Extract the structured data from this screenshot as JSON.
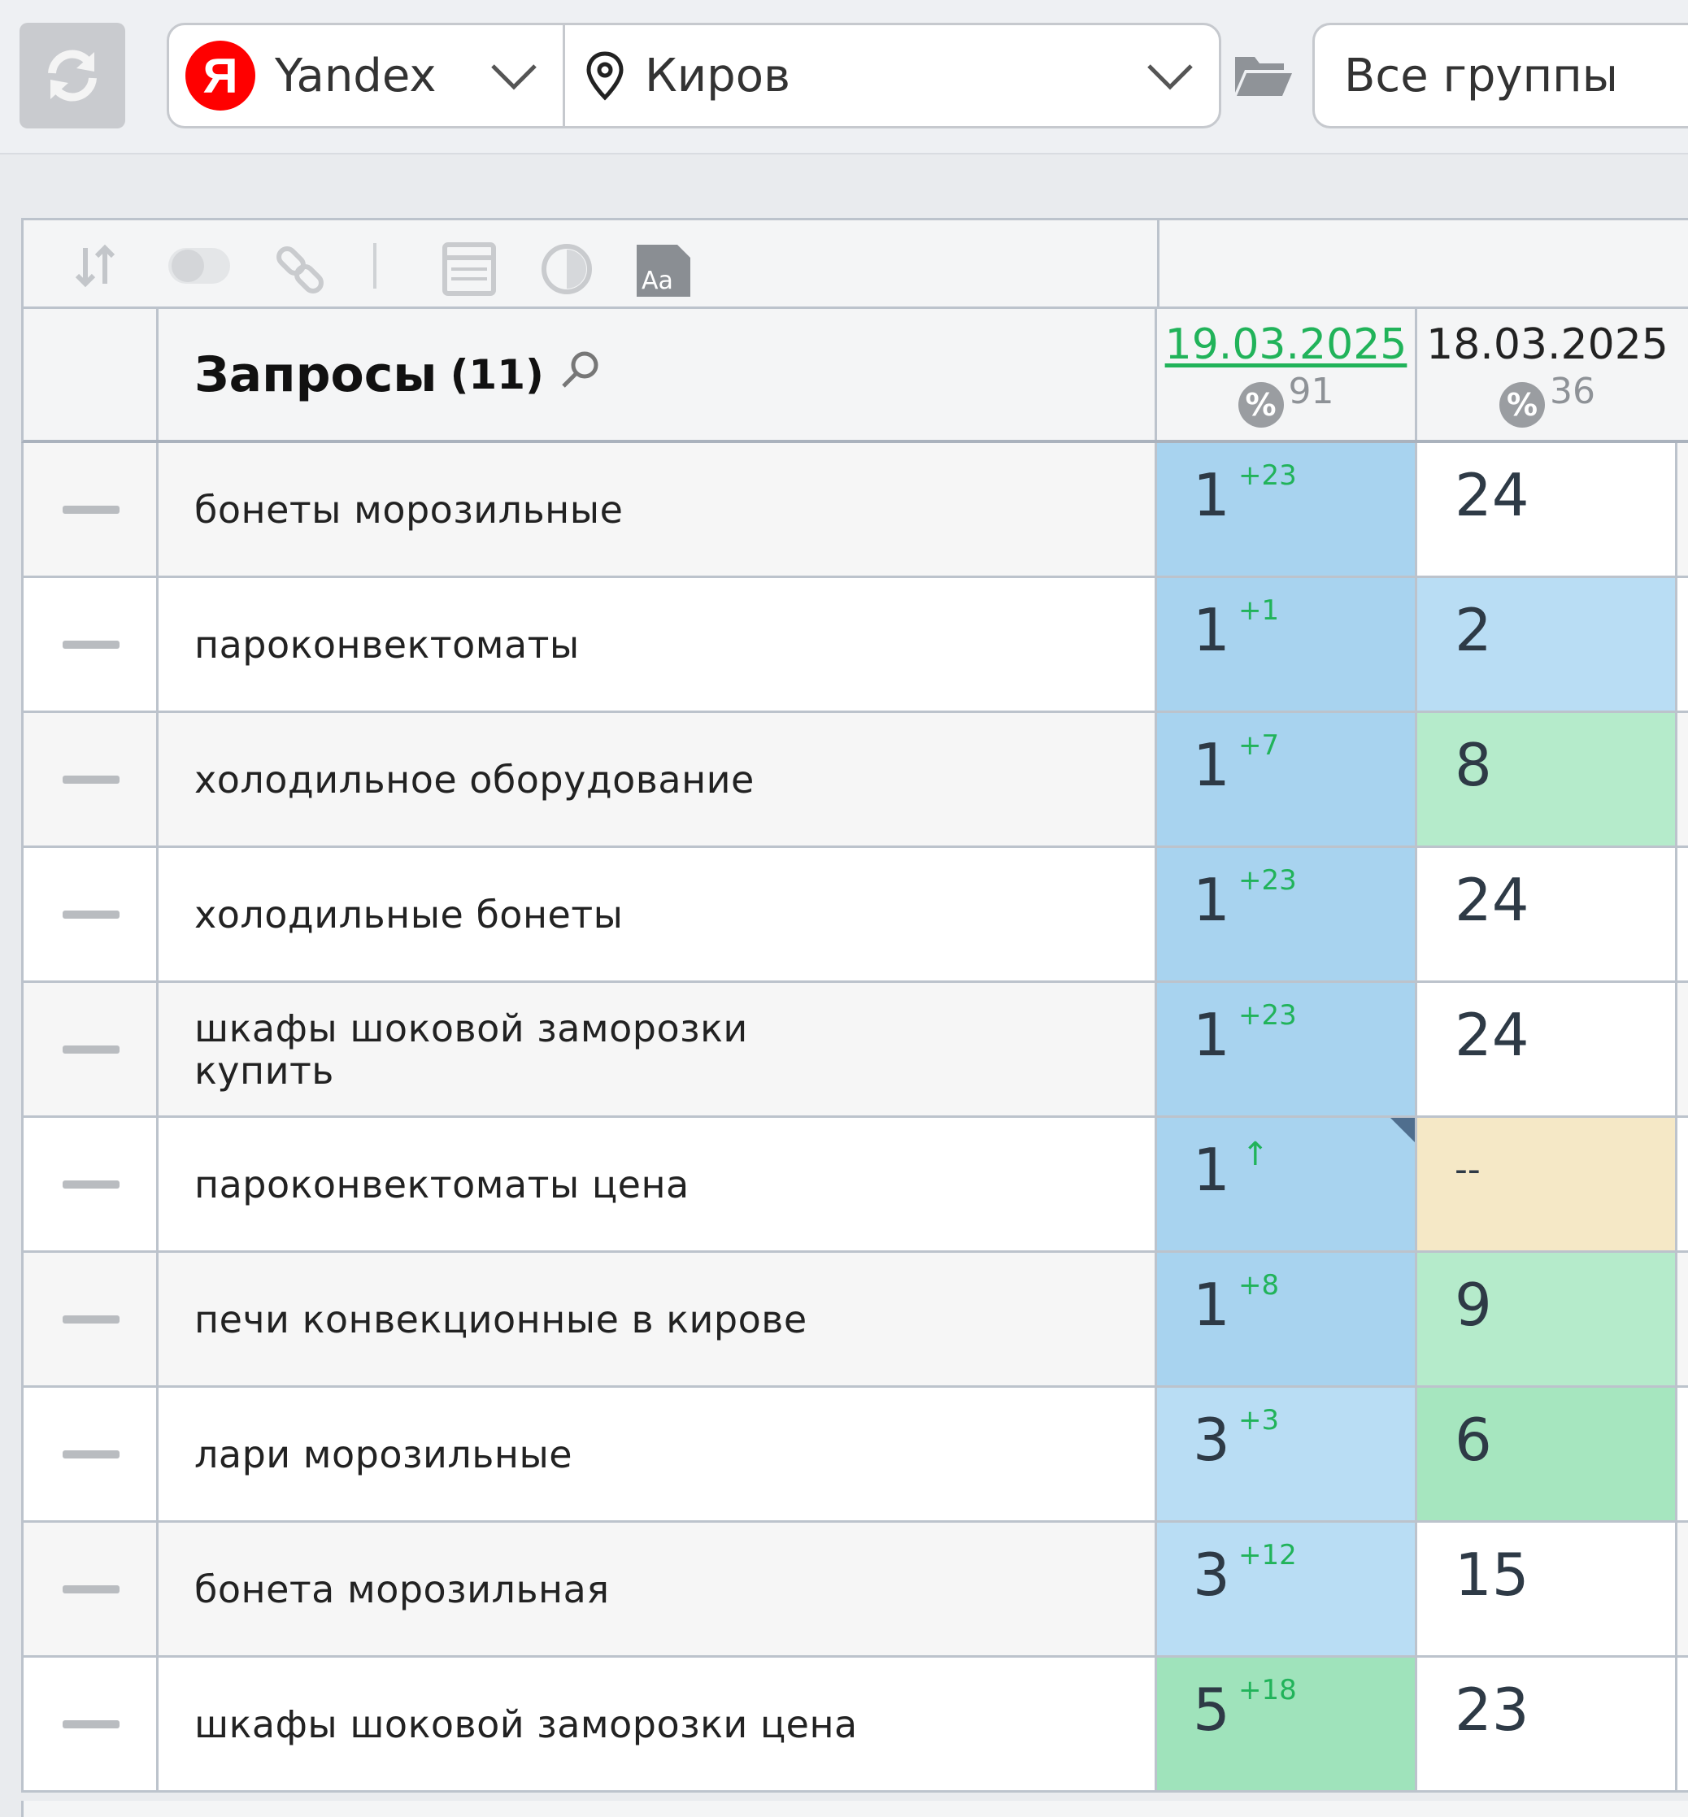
{
  "toolbar": {
    "engine": "Yandex",
    "engine_logo": "Я",
    "region": "Киров",
    "group": "Все группы"
  },
  "table": {
    "title": "Запросы",
    "count": "(11)",
    "dates": [
      {
        "date": "19.03.2025",
        "pct": "91"
      },
      {
        "date": "18.03.2025",
        "pct": "36"
      }
    ],
    "rows": [
      {
        "query": "бонеты морозильные",
        "pos": "1",
        "delta": "+23",
        "prev": "24"
      },
      {
        "query": "пароконвектоматы",
        "pos": "1",
        "delta": "+1",
        "prev": "2"
      },
      {
        "query": "холодильное оборудование",
        "pos": "1",
        "delta": "+7",
        "prev": "8"
      },
      {
        "query": "холодильные бонеты",
        "pos": "1",
        "delta": "+23",
        "prev": "24"
      },
      {
        "query": "шкафы шоковой заморозки купить",
        "pos": "1",
        "delta": "+23",
        "prev": "24"
      },
      {
        "query": "пароконвектоматы цена",
        "pos": "1",
        "delta": "↑",
        "prev": "--"
      },
      {
        "query": "печи конвекционные в кирове",
        "pos": "1",
        "delta": "+8",
        "prev": "9"
      },
      {
        "query": "лари морозильные",
        "pos": "3",
        "delta": "+3",
        "prev": "6"
      },
      {
        "query": "бонета морозильная",
        "pos": "3",
        "delta": "+12",
        "prev": "15"
      },
      {
        "query": "шкафы шоковой заморозки цена",
        "pos": "5",
        "delta": "+18",
        "prev": "23"
      }
    ]
  },
  "colors": {
    "pos_top1": "#a8d3ef",
    "pos_top3": "#b9ddf4",
    "pos_top5": "#9fe3bb",
    "prev_top3": "#b9ddf4",
    "prev_top10": "#b5ebcb",
    "prev_top5": "#a6e6bf",
    "prev_none": "#f5e8c6",
    "row_odd": "#f6f6f6",
    "row_even": "#ffffff"
  }
}
